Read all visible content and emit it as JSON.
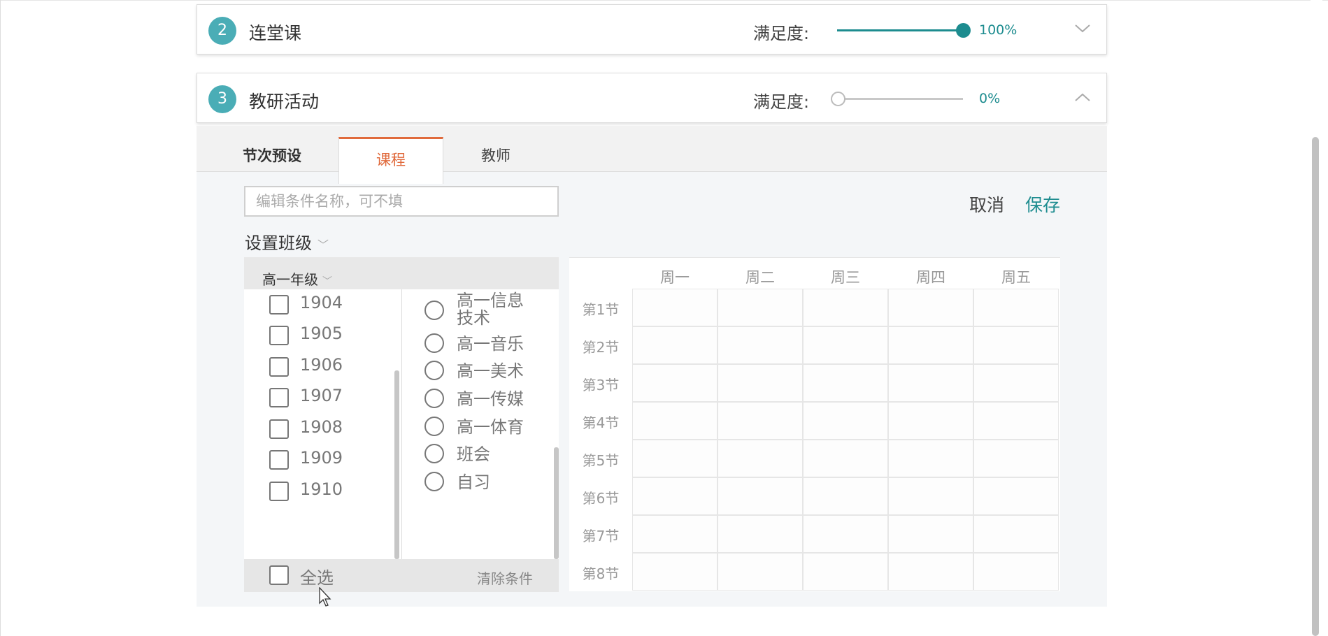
{
  "panels": [
    {
      "badge": "2",
      "title": "连堂课",
      "satisfaction_label": "满足度:",
      "satisfaction_value": "100%",
      "satisfaction_fraction": 1.0,
      "expanded": false,
      "toggle_icon": "chevron-down-icon"
    },
    {
      "badge": "3",
      "title": "教研活动",
      "satisfaction_label": "满足度:",
      "satisfaction_value": "0%",
      "satisfaction_fraction": 0.0,
      "expanded": true,
      "toggle_icon": "chevron-up-icon"
    }
  ],
  "tabs": {
    "preset": "节次预设",
    "course": "课程",
    "teacher": "教师"
  },
  "form": {
    "name_placeholder": "编辑条件名称，可不填",
    "name_value": "",
    "cancel_label": "取消",
    "save_label": "保存",
    "set_class_label": "设置班级"
  },
  "selector": {
    "grade": "高一年级",
    "classes": [
      "1904",
      "1905",
      "1906",
      "1907",
      "1908",
      "1909",
      "1910"
    ],
    "courses": [
      "高一信息技术",
      "高一音乐",
      "高一美术",
      "高一传媒",
      "高一体育",
      "班会",
      "自习"
    ],
    "select_all_label": "全选",
    "clear_label": "清除条件"
  },
  "timetable": {
    "days": [
      "周一",
      "周二",
      "周三",
      "周四",
      "周五"
    ],
    "periods": [
      "第1节",
      "第2节",
      "第3节",
      "第4节",
      "第5节",
      "第6节",
      "第7节",
      "第8节"
    ]
  },
  "colors": {
    "accent": "#1d8c8f",
    "badge": "#4aadb6",
    "active_tab": "#e06a3c"
  }
}
